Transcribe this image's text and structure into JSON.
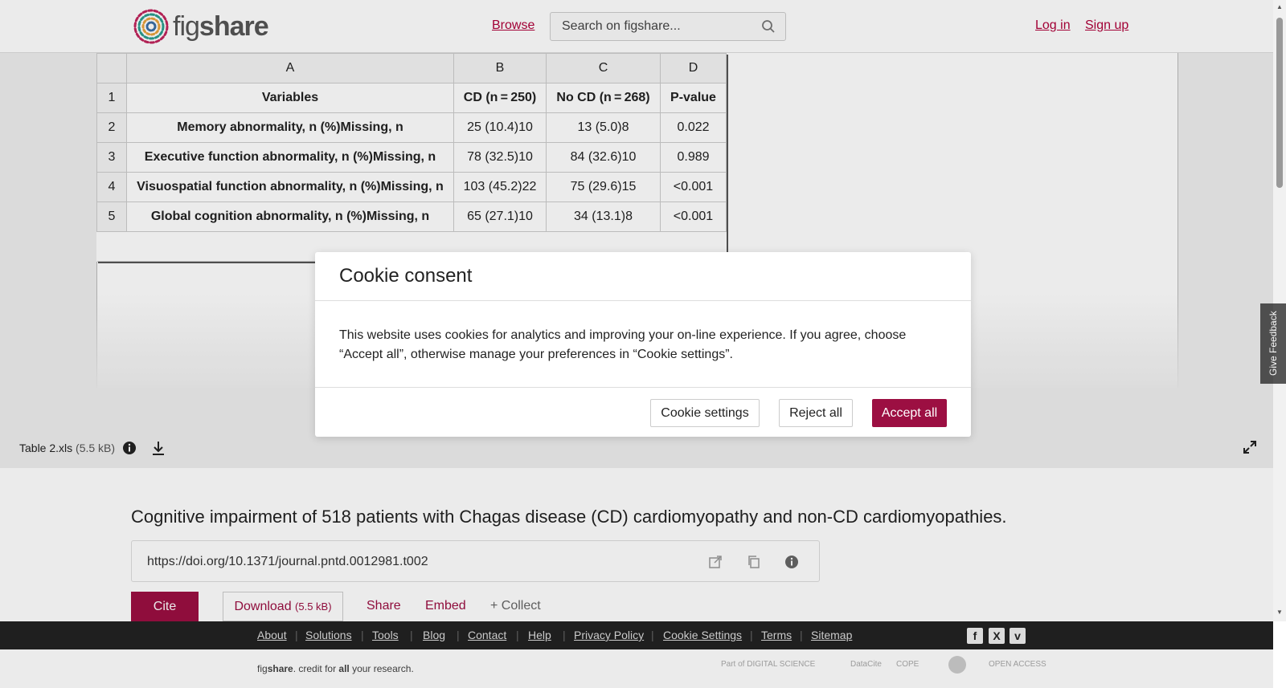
{
  "header": {
    "logo_text_light": "fig",
    "logo_text_bold": "share",
    "browse_label": "Browse",
    "search_placeholder": "Search on figshare...",
    "login_label": "Log in",
    "signup_label": "Sign up"
  },
  "sheet": {
    "columns": [
      "A",
      "B",
      "C",
      "D"
    ],
    "rows": [
      {
        "num": "1",
        "cells": [
          "Variables",
          "CD (n = 250)",
          "No CD (n = 268)",
          "P-value"
        ]
      },
      {
        "num": "2",
        "cells": [
          "Memory abnormality, n (%)Missing, n",
          "25 (10.4)10",
          "13 (5.0)8",
          "0.022"
        ]
      },
      {
        "num": "3",
        "cells": [
          "Executive function abnormality, n (%)Missing, n",
          "78 (32.5)10",
          "84 (32.6)10",
          "0.989"
        ]
      },
      {
        "num": "4",
        "cells": [
          "Visuospatial function abnormality, n (%)Missing, n",
          "103 (45.2)22",
          "75 (29.6)15",
          "<0.001"
        ]
      },
      {
        "num": "5",
        "cells": [
          "Global cognition abnormality, n (%)Missing, n",
          "65 (27.1)10",
          "34 (13.1)8",
          "<0.001"
        ]
      }
    ]
  },
  "file": {
    "name": "Table 2.xls",
    "size": "(5.5 kB)"
  },
  "item": {
    "title": "Cognitive impairment of 518 patients with Chagas disease (CD) cardiomyopathy and non-CD cardiomyopathies.",
    "doi": "https://doi.org/10.1371/journal.pntd.0012981.t002",
    "cite_label": "Cite",
    "download_label": "Download",
    "download_size": "(5.5 kB)",
    "share_label": "Share",
    "embed_label": "Embed",
    "collect_label": "+ Collect"
  },
  "footer": {
    "links": [
      "About",
      "Solutions",
      "Tools",
      "Blog",
      "Contact",
      "Help",
      "Privacy Policy",
      "Cookie Settings",
      "Terms",
      "Sitemap"
    ],
    "tagline_fig": "fig",
    "tagline_share": "share",
    "tagline_mid": ". credit for ",
    "tagline_all": "all",
    "tagline_end": " your research.",
    "partners": [
      "Part of DIGITAL SCIENCE",
      "DataCite",
      "COPE",
      "",
      "OPEN ACCESS"
    ]
  },
  "feedback_label": "Give Feedback",
  "cookie": {
    "title": "Cookie consent",
    "body": "This website uses cookies for analytics and improving your on-line experience. If you agree, choose “Accept all”, otherwise manage your preferences in “Cookie settings”.",
    "settings_label": "Cookie settings",
    "reject_label": "Reject all",
    "accept_label": "Accept all"
  },
  "colors": {
    "brand": "#9c0f42",
    "link": "#b0003a"
  }
}
